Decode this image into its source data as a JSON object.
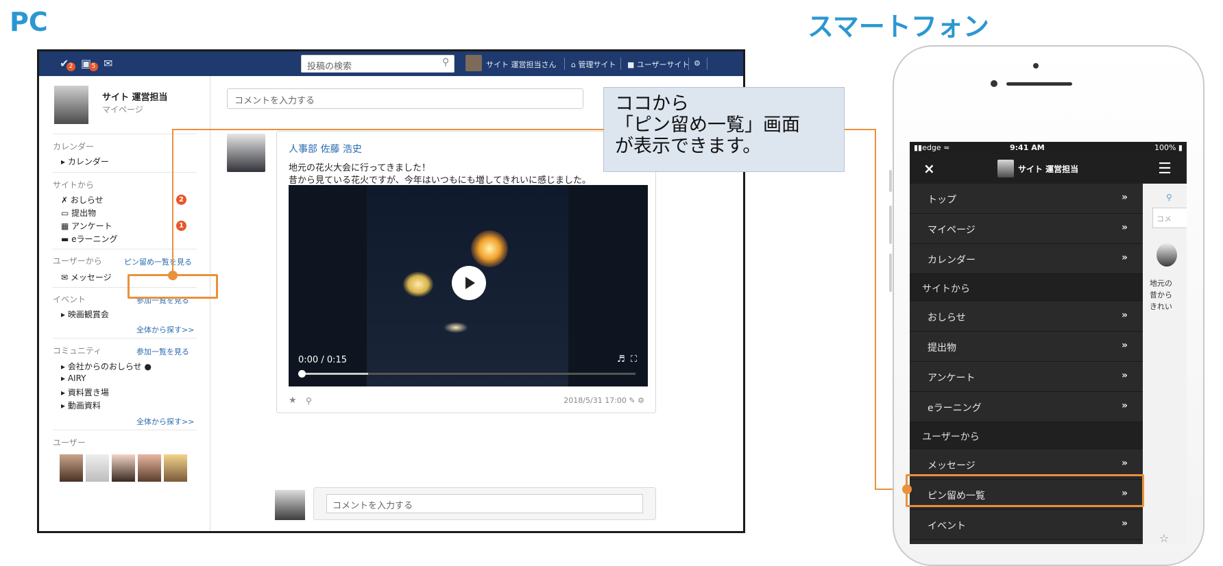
{
  "headings": {
    "pc": "PC",
    "smartphone": "スマートフォン"
  },
  "pc": {
    "topbar": {
      "badge_1": "2",
      "badge_2": "5",
      "search_placeholder": "投稿の検索",
      "user": "サイト 運営担当さん",
      "admin_link": "管理サイト",
      "user_site_link": "ユーザーサイト"
    },
    "sidebar": {
      "name": "サイト 運営担当",
      "mypage": "マイページ",
      "sec_calendar": "カレンダー",
      "calendar": "カレンダー",
      "sec_site": "サイトから",
      "notice": "おしらせ",
      "notice_badge": "2",
      "submission": "提出物",
      "survey": "アンケート",
      "survey_badge": "1",
      "elearning": "eラーニング",
      "sec_user": "ユーザーから",
      "pin_list_link": "ピン留め一覧を見る",
      "message": "メッセージ",
      "sec_event": "イベント",
      "event_join_link": "参加一覧を見る",
      "movie": "映画観賞会",
      "event_search": "全体から探す>>",
      "sec_community": "コミュニティ",
      "community_join_link": "参加一覧を見る",
      "community_1": "会社からのおしらせ",
      "community_2": "AIRY",
      "community_3": "資料置き場",
      "community_4": "動画資料",
      "community_search": "全体から探す>>",
      "sec_users": "ユーザー"
    },
    "main": {
      "comment_placeholder": "コメントを入力する",
      "post": {
        "author": "人事部 佐藤 浩史",
        "line1": "地元の花火大会に行ってきました！",
        "line2": "昔から見ている花火ですが、今年はいつもにも増してきれいに感じました。",
        "video_time": "0:00 / 0:15",
        "video_progress": 0.2,
        "date": "2018/5/31 17:00"
      },
      "reply_placeholder": "コメントを入力する"
    },
    "callout": {
      "line1": "ココから",
      "line2": "「ピン留め一覧」画面",
      "line3": "が表示できます。"
    }
  },
  "phone": {
    "status": {
      "carrier": "edge",
      "time": "9:41 AM",
      "battery": "100%"
    },
    "header_title": "サイト 運営担当",
    "close": "×",
    "menu": [
      {
        "label": "トップ",
        "arrow": "»"
      },
      {
        "label": "マイページ",
        "arrow": "»"
      },
      {
        "label": "カレンダー",
        "arrow": "»"
      }
    ],
    "sec_site": "サイトから",
    "menu_site": [
      {
        "label": "おしらせ",
        "arrow": "»"
      },
      {
        "label": "提出物",
        "arrow": "»"
      },
      {
        "label": "アンケート",
        "arrow": "»"
      },
      {
        "label": "eラーニング",
        "arrow": "»"
      }
    ],
    "sec_user": "ユーザーから",
    "menu_user": [
      {
        "label": "メッセージ",
        "arrow": "»"
      },
      {
        "label": "ピン留め一覧",
        "arrow": "»"
      },
      {
        "label": "イベント",
        "arrow": "»"
      }
    ],
    "strip_text": {
      "t1": "地元の",
      "t2": "昔から",
      "t3": "きれい",
      "comment": "コメ"
    }
  }
}
